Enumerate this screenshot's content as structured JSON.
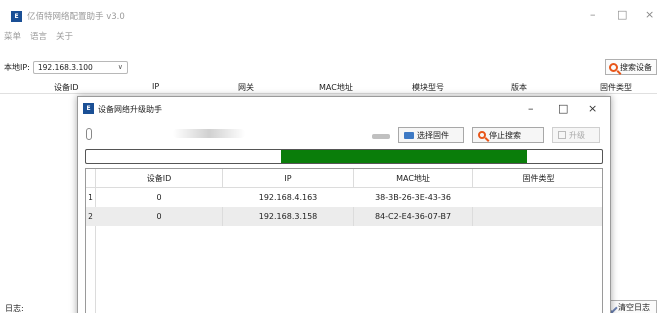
{
  "app": {
    "title": "亿佰特网络配置助手 v3.0",
    "icon_text": "E",
    "window_controls": {
      "minimize": "–",
      "maximize": "□",
      "close": "×"
    }
  },
  "menu": {
    "items": [
      "菜单",
      "语言",
      "关于"
    ]
  },
  "local_ip": {
    "label": "本地IP:",
    "value": "192.168.3.100"
  },
  "search_button": {
    "label": "搜索设备",
    "icon": "search-icon",
    "icon_color": "#e8561a"
  },
  "main_table": {
    "columns": [
      "设备ID",
      "IP",
      "网关",
      "MAC地址",
      "模块型号",
      "版本",
      "固件类型"
    ]
  },
  "log": {
    "label": "日志:"
  },
  "clear_log_button": {
    "label": "清空日志",
    "icon": "broom-icon"
  },
  "dialog": {
    "title": "设备网络升级助手",
    "icon_text": "E",
    "window_controls": {
      "minimize": "–",
      "maximize": "□",
      "close": "×"
    },
    "toolbar": {
      "select_firmware": {
        "label": "选择固件",
        "icon": "folder-icon"
      },
      "stop_search": {
        "label": "停止搜索",
        "icon": "search-icon"
      },
      "upgrade": {
        "label": "升级",
        "icon": "upload-icon",
        "disabled": true
      }
    },
    "progress": {
      "start_fraction": 0.377,
      "end_fraction": 0.855,
      "color": "#0a7d0a"
    },
    "table": {
      "columns": [
        "设备ID",
        "IP",
        "MAC地址",
        "固件类型"
      ],
      "rows": [
        {
          "index": "1",
          "device_id": "0",
          "ip": "192.168.4.163",
          "mac": "38-3B-26-3E-43-36",
          "firmware_type": ""
        },
        {
          "index": "2",
          "device_id": "0",
          "ip": "192.168.3.158",
          "mac": "84-C2-E4-36-07-B7",
          "firmware_type": ""
        }
      ]
    }
  }
}
